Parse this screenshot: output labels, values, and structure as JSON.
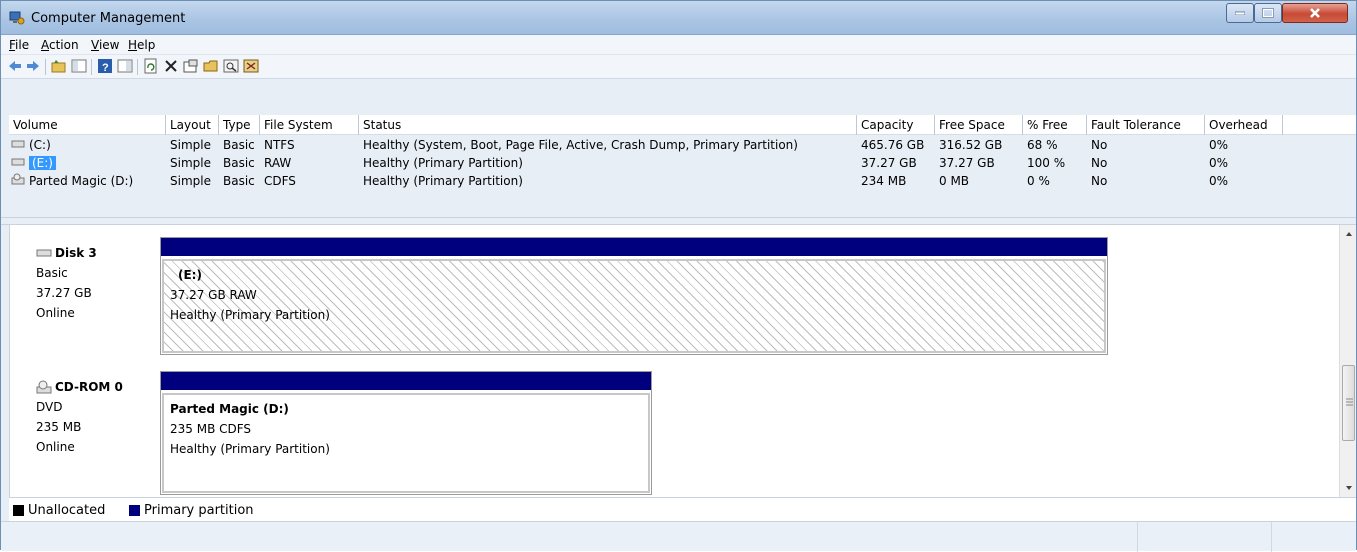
{
  "window": {
    "title": "Computer Management"
  },
  "menu": {
    "file": {
      "accel": "F",
      "rest": "ile"
    },
    "action": {
      "accel": "A",
      "rest": "ction"
    },
    "view": {
      "accel": "V",
      "rest": "iew"
    },
    "help": {
      "accel": "H",
      "rest": "elp"
    }
  },
  "toolbar": {
    "icons": [
      "back-arrow-icon",
      "forward-arrow-icon",
      "up-folder-icon",
      "show-hide-tree-icon",
      "help-icon",
      "properties-pane-icon",
      "refresh-icon",
      "delete-icon",
      "properties-icon",
      "open-icon",
      "search-icon",
      "rescan-icon"
    ]
  },
  "volume_table": {
    "headers": [
      "Volume",
      "Layout",
      "Type",
      "File System",
      "Status",
      "Capacity",
      "Free Space",
      "% Free",
      "Fault Tolerance",
      "Overhead"
    ],
    "rows": [
      {
        "volume": "(C:)",
        "layout": "Simple",
        "type": "Basic",
        "fs": "NTFS",
        "status": "Healthy (System, Boot, Page File, Active, Crash Dump, Primary Partition)",
        "capacity": "465.76 GB",
        "free": "316.52 GB",
        "pct": "68 %",
        "fault": "No",
        "overhead": "0%"
      },
      {
        "volume": "(E:)",
        "layout": "Simple",
        "type": "Basic",
        "fs": "RAW",
        "status": "Healthy (Primary Partition)",
        "capacity": "37.27 GB",
        "free": "37.27 GB",
        "pct": "100 %",
        "fault": "No",
        "overhead": "0%"
      },
      {
        "volume": "Parted Magic (D:)",
        "layout": "Simple",
        "type": "Basic",
        "fs": "CDFS",
        "status": "Healthy (Primary Partition)",
        "capacity": "234 MB",
        "free": "0 MB",
        "pct": "0 %",
        "fault": "No",
        "overhead": "0%"
      }
    ]
  },
  "disks": [
    {
      "name": "Disk 3",
      "kind": "Basic",
      "size": "37.27 GB",
      "state": "Online",
      "partition": {
        "name": "(E:)",
        "info": "37.27 GB RAW",
        "status": "Healthy (Primary Partition)"
      }
    },
    {
      "name": "CD-ROM 0",
      "kind": "DVD",
      "size": "235 MB",
      "state": "Online",
      "partition": {
        "name": "Parted Magic  (D:)",
        "info": "235 MB CDFS",
        "status": "Healthy (Primary Partition)"
      }
    }
  ],
  "legend": {
    "unallocated": "Unallocated",
    "primary": "Primary partition",
    "unallocated_color": "#000000",
    "primary_color": "#00007f"
  },
  "colors": {
    "partition_header": "#00007f",
    "selection": "#3399ff"
  }
}
